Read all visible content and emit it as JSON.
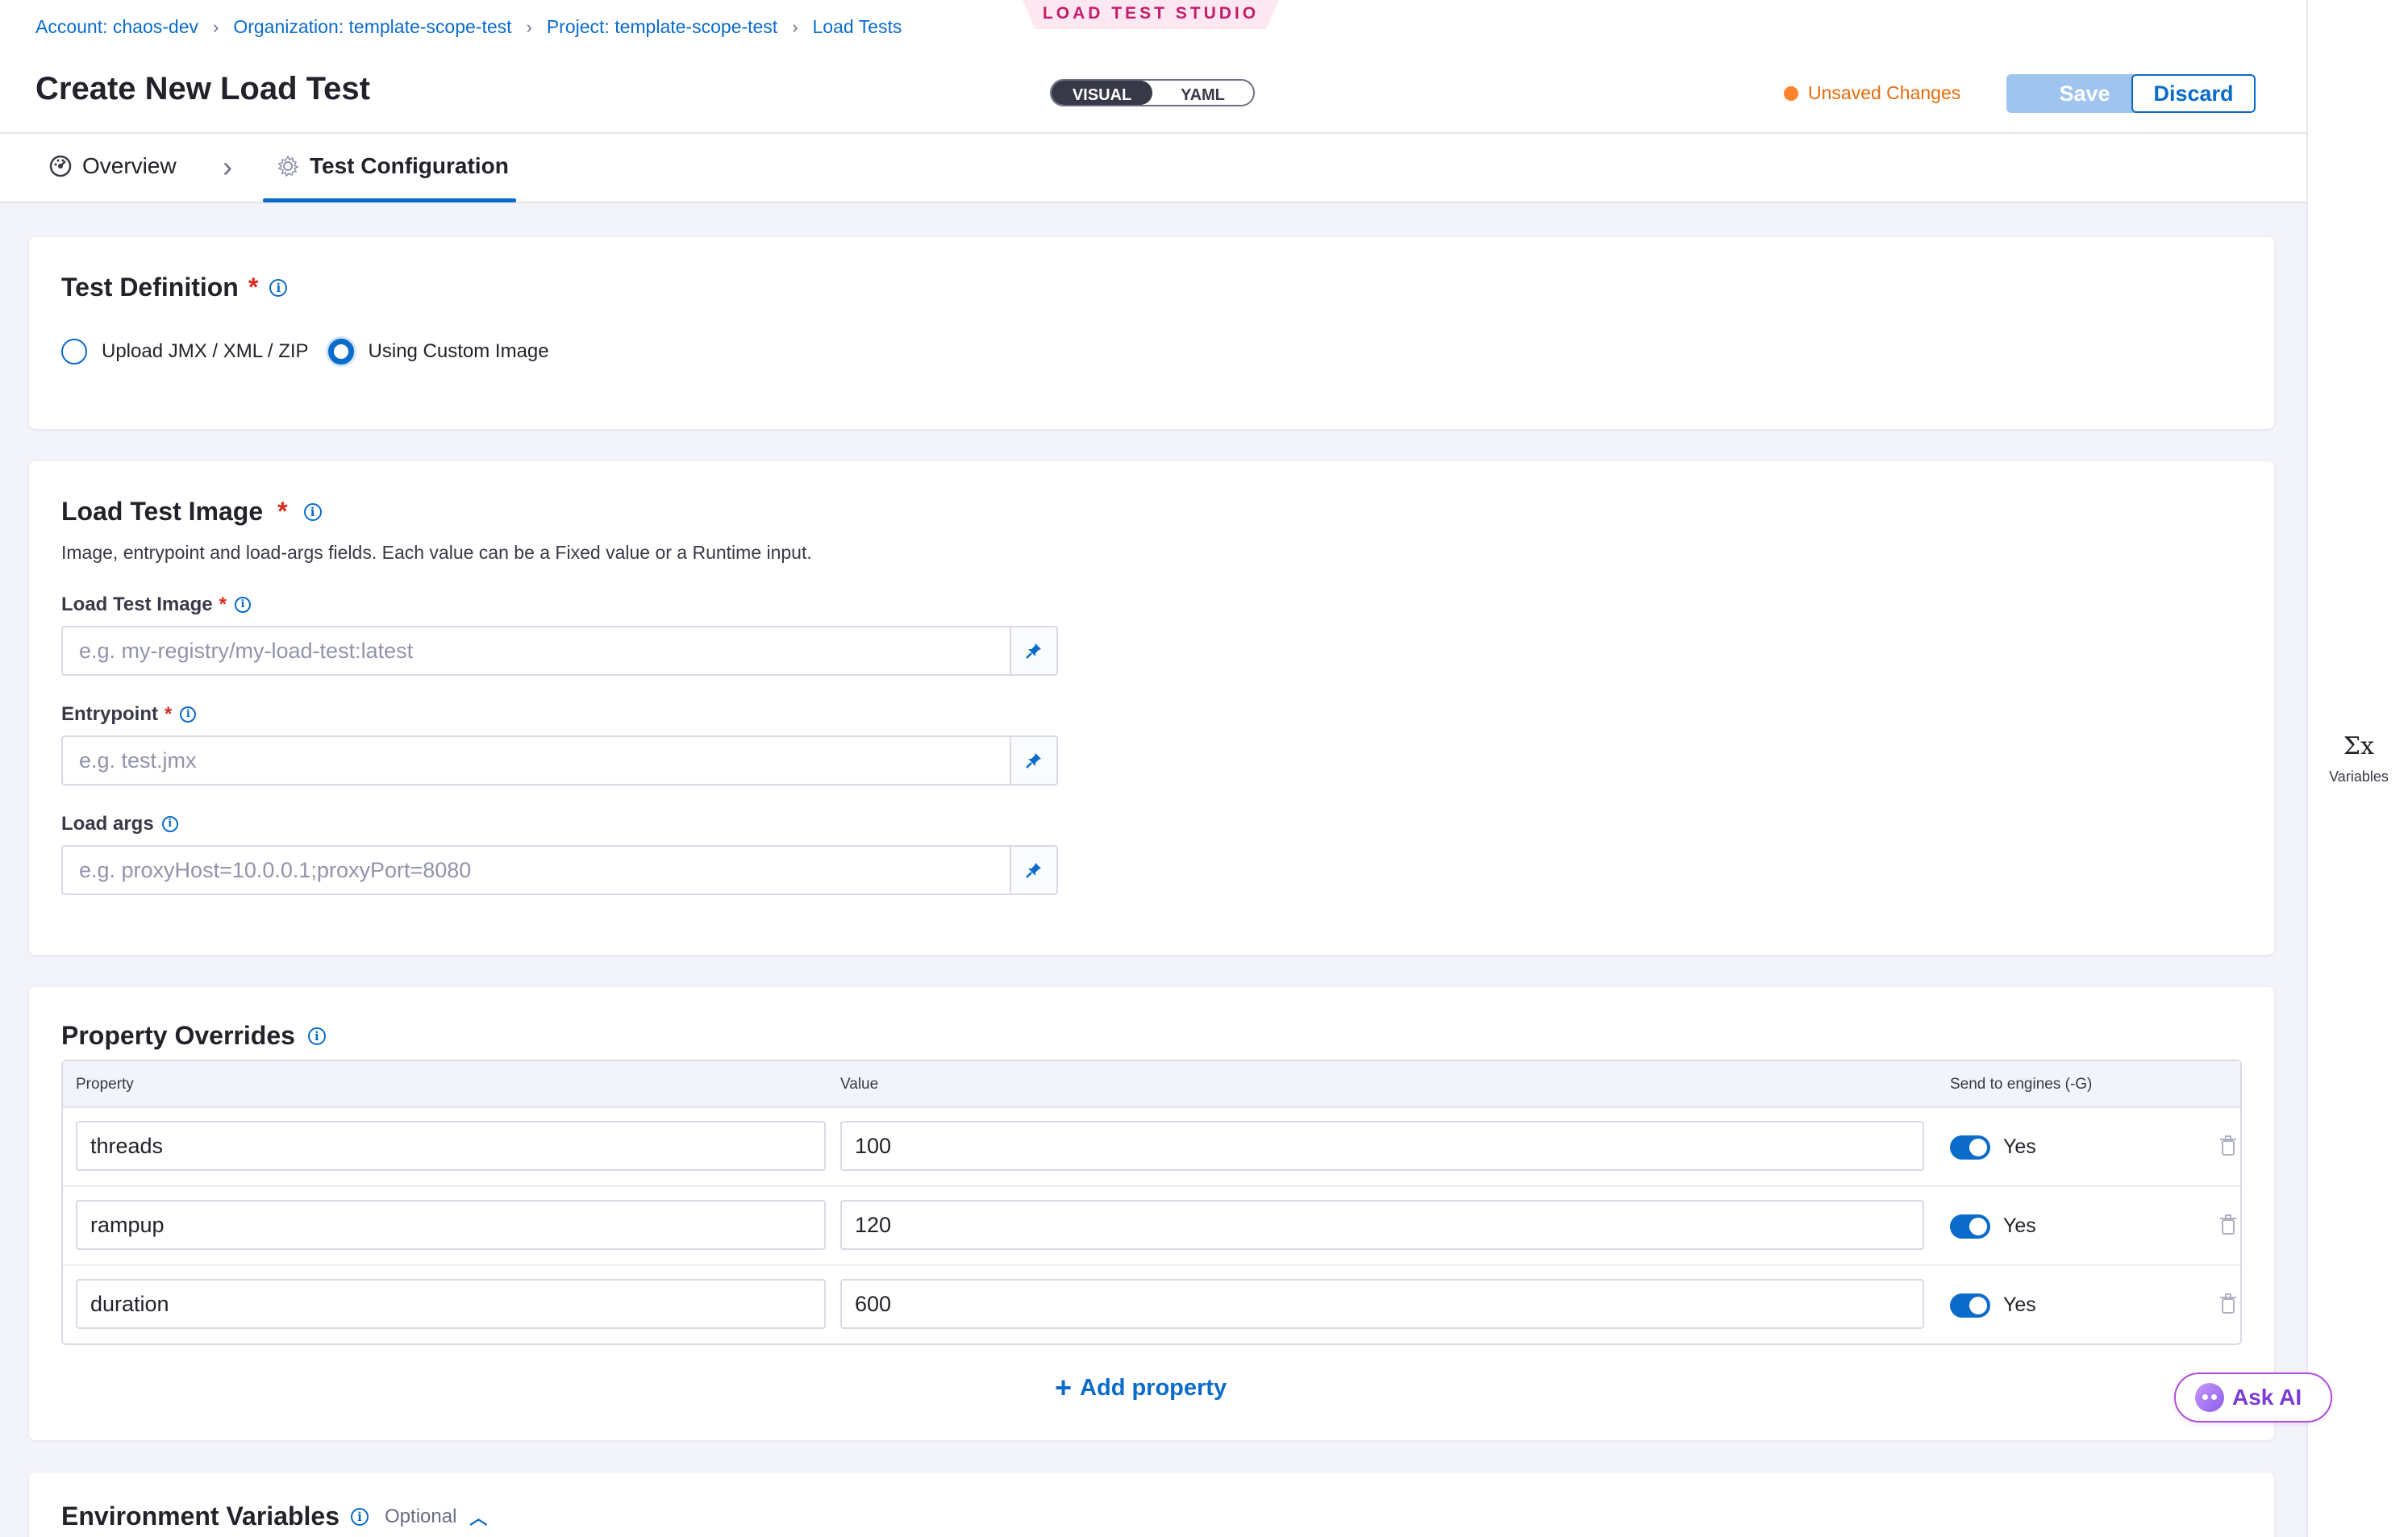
{
  "header": {
    "breadcrumbs": [
      "Account: chaos-dev",
      "Organization: template-scope-test",
      "Project: template-scope-test",
      "Load Tests"
    ],
    "title": "Create New Load Test",
    "studio_badge": "LOAD TEST STUDIO",
    "mode_toggle": {
      "options": [
        "VISUAL",
        "YAML"
      ],
      "selected": "VISUAL"
    },
    "unsaved_text": "Unsaved Changes",
    "save_label": "Save",
    "discard_label": "Discard"
  },
  "tabs": [
    {
      "label": "Overview",
      "icon": "dashboard-icon"
    },
    {
      "label": "Test Configuration",
      "icon": "gear-icon",
      "active": true
    }
  ],
  "test_definition": {
    "title": "Test Definition",
    "required": "*",
    "options": [
      {
        "label": "Upload JMX / XML / ZIP",
        "selected": false
      },
      {
        "label": "Using Custom Image",
        "selected": true
      }
    ]
  },
  "load_test_image": {
    "title": "Load Test Image",
    "required": "*",
    "description": "Image, entrypoint and load-args fields. Each value can be a Fixed value or a Runtime input.",
    "fields": [
      {
        "label": "Load Test Image",
        "required": "*",
        "placeholder": "e.g. my-registry/my-load-test:latest",
        "value": ""
      },
      {
        "label": "Entrypoint",
        "required": "*",
        "placeholder": "e.g. test.jmx",
        "value": ""
      },
      {
        "label": "Load args",
        "required": "",
        "placeholder": "e.g. proxyHost=10.0.0.1;proxyPort=8080",
        "value": ""
      }
    ]
  },
  "property_overrides": {
    "title": "Property Overrides",
    "columns": [
      "Property",
      "Value",
      "Send to engines (-G)"
    ],
    "rows": [
      {
        "property": "threads",
        "value": "100",
        "send": "Yes",
        "enabled": true
      },
      {
        "property": "rampup",
        "value": "120",
        "send": "Yes",
        "enabled": true
      },
      {
        "property": "duration",
        "value": "600",
        "send": "Yes",
        "enabled": true
      }
    ],
    "add_label": "Add property"
  },
  "environment_variables": {
    "title": "Environment Variables",
    "optional_label": "Optional"
  },
  "right_rail": {
    "variables_label": "Variables",
    "variables_symbol": "Σx"
  },
  "ask_ai_label": "Ask AI",
  "colors": {
    "accent": "#0b6bcb",
    "warning": "#ff832b",
    "required": "#da291d",
    "badge": "#c41c6b"
  }
}
